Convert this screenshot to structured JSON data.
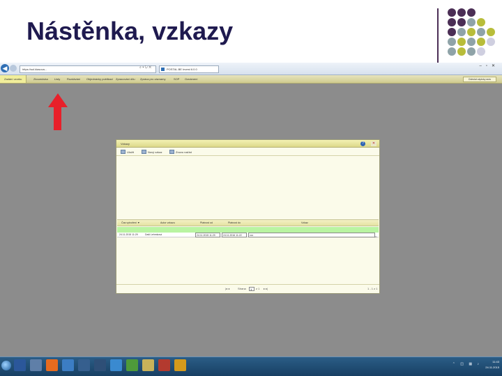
{
  "slide": {
    "title": "Nástěnka, vzkazy"
  },
  "browser": {
    "address": "https://sol.klasova...",
    "address_icons": "⌕ ▾ ↻ ✕",
    "tab_label": "POSTAL.BE Invest 6.0.0",
    "window_controls": "–▫✕"
  },
  "nav": {
    "active": "Zadání vzorku",
    "items": [
      "Zkoumávka",
      "Listy",
      "Rozdávání",
      "Objednávky publikaci",
      "Zpracování dílu",
      "Zpráva pro záznamy",
      "SOP",
      "Oznámení"
    ],
    "right_button": "Odeslat zápisky auto"
  },
  "dialog": {
    "title": "Vzkazy",
    "toolbar": [
      "Uložit",
      "Nový vzkaz",
      "Znovu načíst"
    ],
    "columns": [
      "Čas vytvoření ▼",
      "Autor vzkazu",
      "Platnost od",
      "Platnost do",
      "Vzkaz"
    ],
    "rows": [
      [
        "24.11.2015 11:29",
        "Daši Lehmková",
        "24.11.2015 11:29",
        "24.11.2016 11:22",
        "xxx"
      ]
    ],
    "pager": {
      "nav_left": "|◂ ◂",
      "page_label": "Strana",
      "page_value": "1",
      "of_label": "z 1",
      "nav_right": "▸ ▸|",
      "range": "1 - 1 z 1"
    },
    "help_glyph": "?",
    "close_glyph": "✕"
  },
  "taskbar": {
    "time": "11:43",
    "date": "24.11.2015",
    "tray_glyphs": "⌃ ◫ ▦ ♪"
  },
  "colors": {
    "title": "#1f1a4f",
    "accent_line": "#4b2e55",
    "arrow": "#e8202a",
    "dots": [
      "#4b2e55",
      "#8fa3a8",
      "#b8bd3a",
      "#cfcfe0"
    ]
  }
}
